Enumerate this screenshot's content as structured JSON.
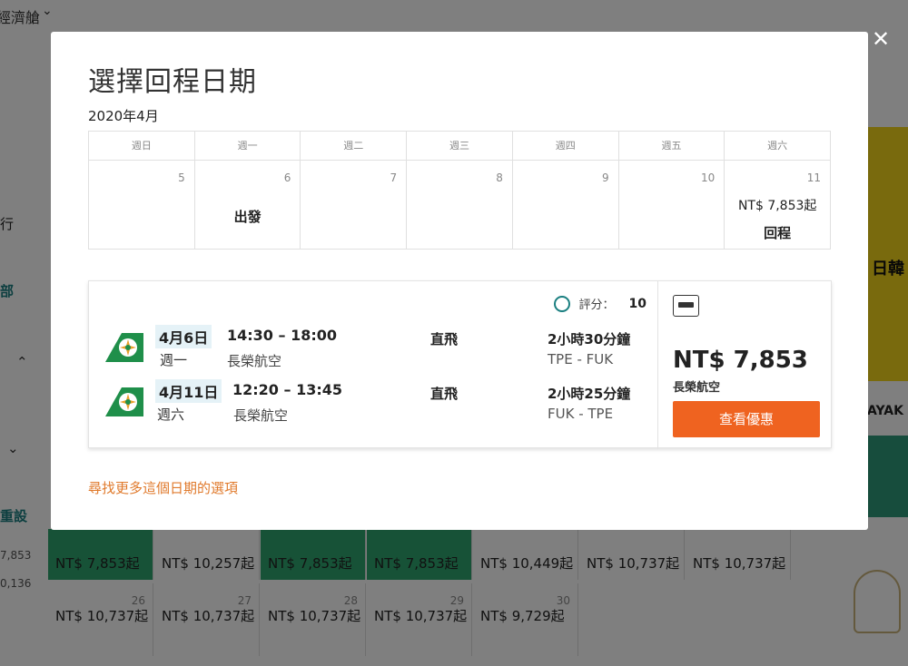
{
  "background": {
    "top_label": "經濟艙",
    "left_labels": [
      "行",
      "部",
      "重設",
      "7,853",
      "0,136"
    ],
    "row1_prices": [
      "NT$ 7,853起",
      "NT$ 10,257起",
      "NT$ 7,853起",
      "NT$ 7,853起",
      "NT$ 10,449起",
      "NT$ 10,737起",
      "NT$ 10,737起"
    ],
    "row2_days": [
      "26",
      "27",
      "28",
      "29",
      "30"
    ],
    "row2_prices": [
      "NT$ 10,737起",
      "NT$ 10,737起",
      "NT$ 10,737起",
      "NT$ 10,737起",
      "NT$ 9,729起"
    ],
    "banner_text": "日韓",
    "ad_text": "AYAK"
  },
  "modal": {
    "title": "選擇回程日期",
    "month": "2020年4月",
    "weekdays": [
      "週日",
      "週一",
      "週二",
      "週三",
      "週四",
      "週五",
      "週六"
    ],
    "days": [
      "5",
      "6",
      "7",
      "8",
      "9",
      "10",
      "11"
    ],
    "depart_label": "出發",
    "return_price": "NT$ 7,853起",
    "return_label": "回程",
    "rating_label": "評分：",
    "rating_value": "10",
    "legs": [
      {
        "date": "4月6日",
        "dow": "週一",
        "time": "14:30 – 18:00",
        "airline": "長榮航空",
        "stops": "直飛",
        "duration": "2小時30分鐘",
        "route": "TPE - FUK"
      },
      {
        "date": "4月11日",
        "dow": "週六",
        "time": "12:20 – 13:45",
        "airline": "長榮航空",
        "stops": "直飛",
        "duration": "2小時25分鐘",
        "route": "FUK - TPE"
      }
    ],
    "price": "NT$ 7,853",
    "price_airline": "長榮航空",
    "deal_button": "查看優惠",
    "more_link": "尋找更多這個日期的選項",
    "close": "✕"
  },
  "colors": {
    "accent_orange": "#ef6320",
    "link_orange": "#e07a2c",
    "eva_green": "#1f8f4a",
    "rating_teal": "#1a7f80"
  },
  "icons": [
    "chevron-down-icon",
    "close-icon",
    "rating-circle-icon",
    "payment-card-icon",
    "eva-air-logo-icon"
  ]
}
